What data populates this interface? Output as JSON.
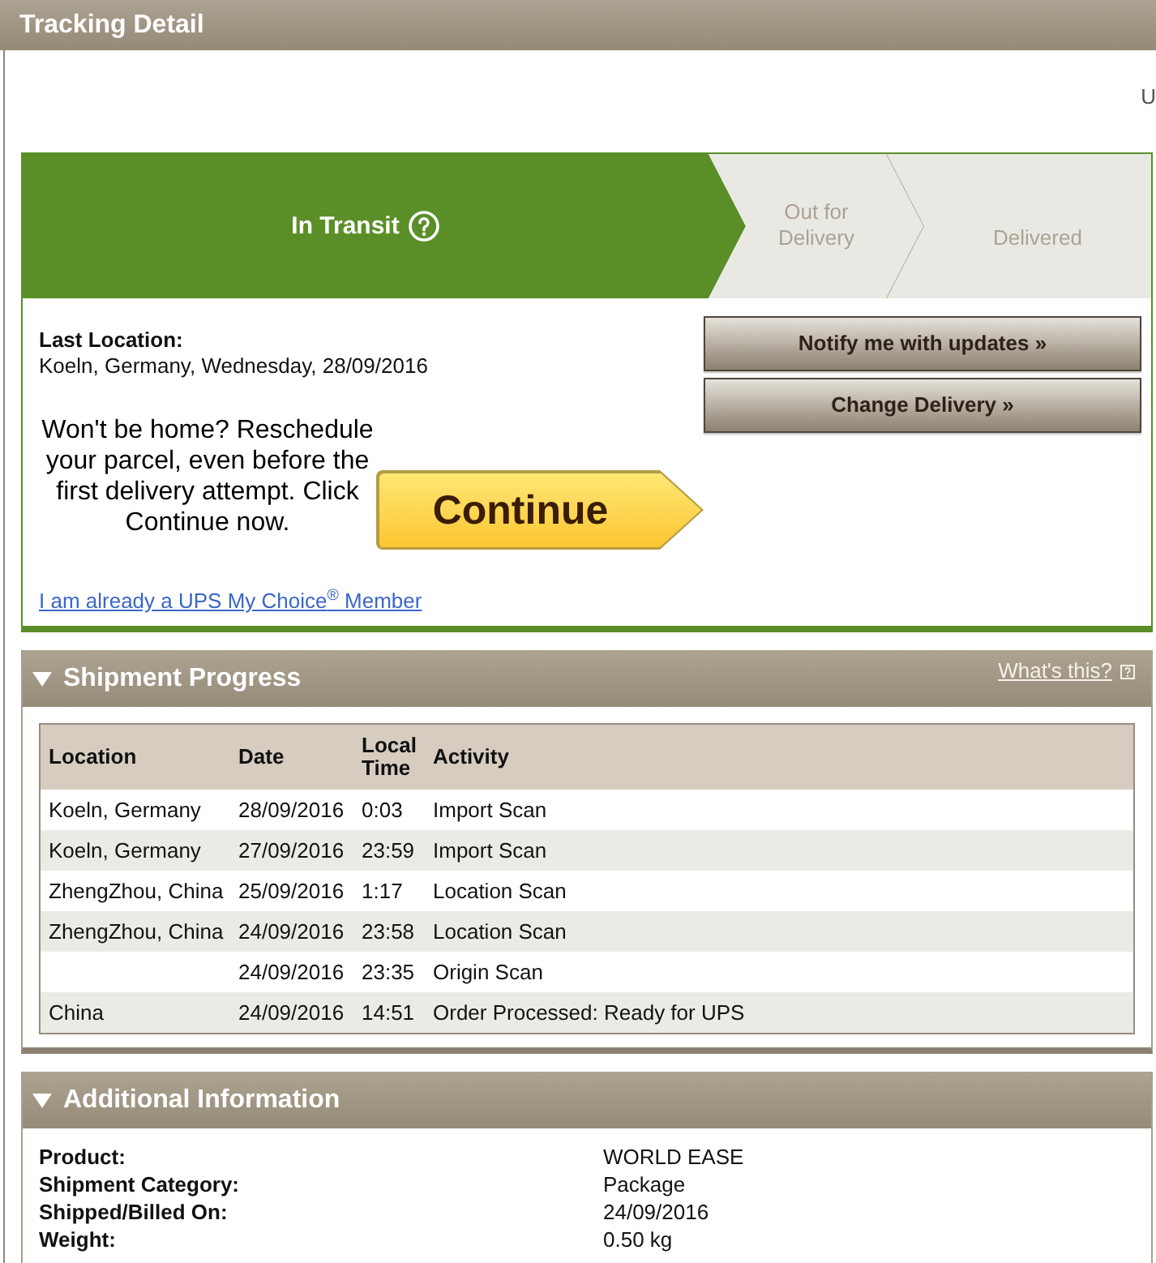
{
  "header": {
    "title": "Tracking Detail"
  },
  "top_right_text": "U",
  "status_tracker": {
    "steps": [
      {
        "label": "In Transit",
        "selected": true,
        "help": true
      },
      {
        "label": "Out for Delivery",
        "selected": false
      },
      {
        "label": "Delivered",
        "selected": false
      }
    ],
    "last_location": {
      "label": "Last Location:",
      "value": "Koeln, Germany, Wednesday, 28/09/2016"
    },
    "buttons": [
      "Notify me with updates »",
      "Change Delivery »"
    ],
    "reschedule_text": "Won't be home? Reschedule your parcel, even before the first delivery attempt. Click Continue now.",
    "continue_button": "Continue",
    "member_link": "I am already a UPS My Choice$^{®}$ Member"
  },
  "shipment_progress": {
    "title": "Shipment Progress",
    "expanded": true,
    "help_link": "What's this?",
    "table": {
      "columns": [
        "Location",
        "Date",
        "Local Time",
        "Activity"
      ],
      "rows": [
        {
          "location": "Koeln, Germany",
          "date": "28/09/2016",
          "local_time": "0:03",
          "activity": "Import Scan"
        },
        {
          "location": "Koeln, Germany",
          "date": "27/09/2016",
          "local_time": "23:59",
          "activity": "Import Scan"
        },
        {
          "location": "ZhengZhou, China",
          "date": "25/09/2016",
          "local_time": "1:17",
          "activity": "Location Scan"
        },
        {
          "location": "ZhengZhou, China",
          "date": "24/09/2016",
          "local_time": "23:58",
          "activity": "Location Scan"
        },
        {
          "date": "24/09/2016",
          "local_time": "23:35",
          "activity": "Origin Scan"
        },
        {
          "location": "China",
          "date": "24/09/2016",
          "local_time": "14:51",
          "activity": "Order Processed: Ready for UPS"
        }
      ]
    }
  },
  "additional_information": {
    "title": "Additional Information",
    "expanded": true,
    "rows": [
      {
        "label": "Product:",
        "value": "WORLD EASE"
      },
      {
        "label": "Shipment Category:",
        "value": "Package"
      },
      {
        "label": "Shipped/Billed On:",
        "value": "24/09/2016"
      },
      {
        "label": "Weight:",
        "value": "0.50 kg"
      }
    ]
  }
}
